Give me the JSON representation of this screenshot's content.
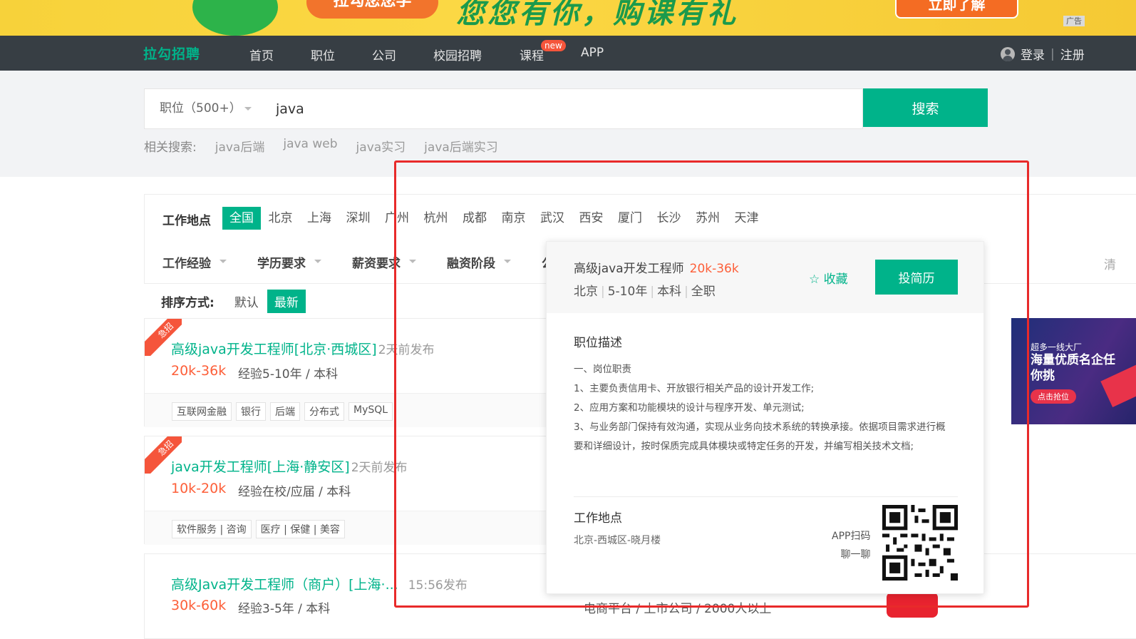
{
  "banner": {
    "left_text": "拉勾您您学",
    "slogan": "您您有你，购课有礼",
    "cta": "立即了解",
    "ad_label": "广告"
  },
  "nav": {
    "logo": "拉勾招聘",
    "items": [
      "首页",
      "职位",
      "公司",
      "校园招聘",
      "课程",
      "APP"
    ],
    "new_badge": "new",
    "login": "登录",
    "separator": "|",
    "register": "注册"
  },
  "search": {
    "type_label": "职位（500+）",
    "query": "java",
    "button": "搜索",
    "related_label": "相关搜索:",
    "related": [
      "java后端",
      "java web",
      "java实习",
      "java后端实习"
    ]
  },
  "filters": {
    "location_label": "工作地点",
    "cities": [
      "全国",
      "北京",
      "上海",
      "深圳",
      "广州",
      "杭州",
      "成都",
      "南京",
      "武汉",
      "西安",
      "厦门",
      "长沙",
      "苏州",
      "天津"
    ],
    "active_city": "全国",
    "dropdowns": [
      "工作经验",
      "学历要求",
      "薪资要求",
      "融资阶段",
      "公"
    ],
    "clear": "清"
  },
  "sort": {
    "label": "排序方式:",
    "options": [
      "默认",
      "最新"
    ],
    "active": "最新"
  },
  "jobs": [
    {
      "urgent": "急招",
      "title": "高级java开发工程师[北京·西城区]",
      "posted": "2天前发布",
      "salary": "20k-36k",
      "requirements": "经验5-10年 / 本科",
      "tags": [
        "互联网金融",
        "银行",
        "后端",
        "分布式",
        "MySQL"
      ]
    },
    {
      "urgent": "急招",
      "title": "java开发工程师[上海·静安区]",
      "posted": "2天前发布",
      "salary": "10k-20k",
      "requirements": "经验在校/应届 / 本科",
      "tags": [
        "软件服务 | 咨询",
        "医疗 | 保健 | 美容"
      ]
    },
    {
      "urgent": "",
      "title": "高级Java开发工程师（商户）[上海·...",
      "posted": "15:56发布",
      "salary": "30k-60k",
      "requirements": "经验3-5年 / 本科",
      "company_meta": "电商平台 / 上市公司 / 2000人以上",
      "tags": []
    }
  ],
  "popup": {
    "title": "高级java开发工程师",
    "salary": "20k-36k",
    "meta": [
      "北京",
      "5-10年",
      "本科",
      "全职"
    ],
    "favorite": "收藏",
    "apply": "投简历",
    "desc_heading": "职位描述",
    "desc_lines": [
      "一、岗位职责",
      "1、主要负责信用卡、开放银行相关产品的设计开发工作;",
      "2、应用方案和功能模块的设计与程序开发、单元测试;",
      "3、与业务部门保持有效沟通，实现从业务向技术系统的转换承接。依据项目需求进行概要和详细设计，按时保质完成具体模块或特定任务的开发，并编写相关技术文档;"
    ],
    "location_heading": "工作地点",
    "address": "北京-西城区-晓月楼",
    "scan_line1": "APP扫码",
    "scan_line2": "聊一聊"
  },
  "side_ad": {
    "line1": "超多一线大厂",
    "line2": "海量优质名企任你挑",
    "button": "点击抢位"
  },
  "colors": {
    "brand_green": "#00b38a",
    "salary_orange": "#fd5f39",
    "highlight_red": "#e82a2a",
    "nav_bg": "#373e44"
  }
}
